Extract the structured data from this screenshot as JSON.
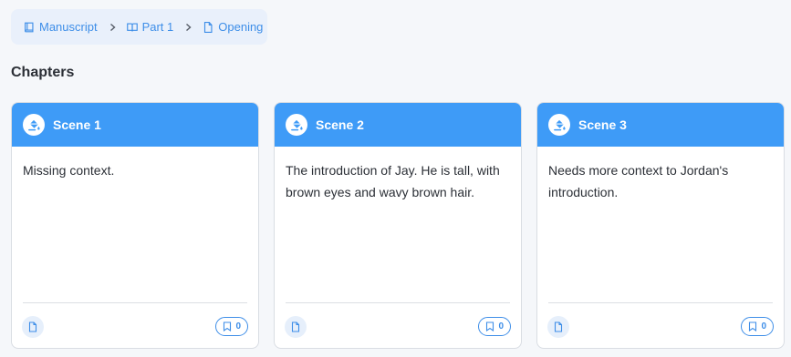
{
  "breadcrumb": {
    "items": [
      {
        "label": "Manuscript",
        "icon": "book-icon"
      },
      {
        "label": "Part 1",
        "icon": "book-open-icon"
      },
      {
        "label": "Opening",
        "icon": "file-icon"
      }
    ]
  },
  "section": {
    "title": "Chapters"
  },
  "cards": [
    {
      "title": "Scene 1",
      "icon": "paint-bucket-icon",
      "text": "Missing context.",
      "bookmarks": "0"
    },
    {
      "title": "Scene 2",
      "icon": "paint-bucket-icon",
      "text": "The introduction of Jay. He is tall, with brown eyes and wavy brown hair.",
      "bookmarks": "0"
    },
    {
      "title": "Scene 3",
      "icon": "paint-bucket-icon",
      "text": "Needs more context to Jordan's introduction.",
      "bookmarks": "0"
    }
  ],
  "colors": {
    "accent": "#3e9bf7",
    "link": "#3e8ee8",
    "breadcrumb_bg": "#e9f0fb",
    "page_bg": "#f5f7fa"
  }
}
